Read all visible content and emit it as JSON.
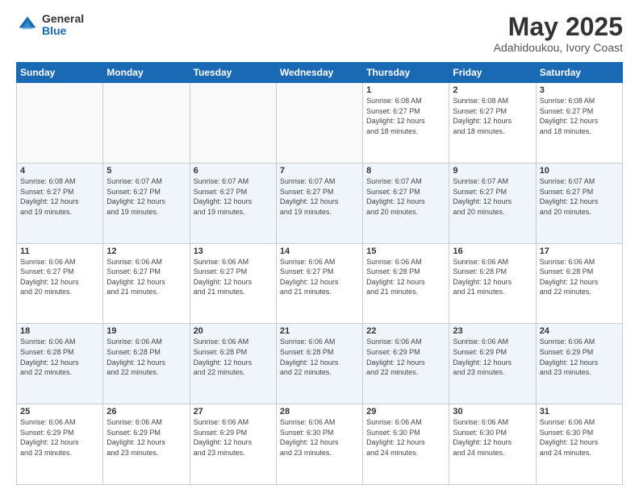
{
  "logo": {
    "general": "General",
    "blue": "Blue"
  },
  "header": {
    "month": "May 2025",
    "location": "Adahidoukou, Ivory Coast"
  },
  "days_of_week": [
    "Sunday",
    "Monday",
    "Tuesday",
    "Wednesday",
    "Thursday",
    "Friday",
    "Saturday"
  ],
  "weeks": [
    [
      {
        "day": "",
        "info": ""
      },
      {
        "day": "",
        "info": ""
      },
      {
        "day": "",
        "info": ""
      },
      {
        "day": "",
        "info": ""
      },
      {
        "day": "1",
        "info": "Sunrise: 6:08 AM\nSunset: 6:27 PM\nDaylight: 12 hours\nand 18 minutes."
      },
      {
        "day": "2",
        "info": "Sunrise: 6:08 AM\nSunset: 6:27 PM\nDaylight: 12 hours\nand 18 minutes."
      },
      {
        "day": "3",
        "info": "Sunrise: 6:08 AM\nSunset: 6:27 PM\nDaylight: 12 hours\nand 18 minutes."
      }
    ],
    [
      {
        "day": "4",
        "info": "Sunrise: 6:08 AM\nSunset: 6:27 PM\nDaylight: 12 hours\nand 19 minutes."
      },
      {
        "day": "5",
        "info": "Sunrise: 6:07 AM\nSunset: 6:27 PM\nDaylight: 12 hours\nand 19 minutes."
      },
      {
        "day": "6",
        "info": "Sunrise: 6:07 AM\nSunset: 6:27 PM\nDaylight: 12 hours\nand 19 minutes."
      },
      {
        "day": "7",
        "info": "Sunrise: 6:07 AM\nSunset: 6:27 PM\nDaylight: 12 hours\nand 19 minutes."
      },
      {
        "day": "8",
        "info": "Sunrise: 6:07 AM\nSunset: 6:27 PM\nDaylight: 12 hours\nand 20 minutes."
      },
      {
        "day": "9",
        "info": "Sunrise: 6:07 AM\nSunset: 6:27 PM\nDaylight: 12 hours\nand 20 minutes."
      },
      {
        "day": "10",
        "info": "Sunrise: 6:07 AM\nSunset: 6:27 PM\nDaylight: 12 hours\nand 20 minutes."
      }
    ],
    [
      {
        "day": "11",
        "info": "Sunrise: 6:06 AM\nSunset: 6:27 PM\nDaylight: 12 hours\nand 20 minutes."
      },
      {
        "day": "12",
        "info": "Sunrise: 6:06 AM\nSunset: 6:27 PM\nDaylight: 12 hours\nand 21 minutes."
      },
      {
        "day": "13",
        "info": "Sunrise: 6:06 AM\nSunset: 6:27 PM\nDaylight: 12 hours\nand 21 minutes."
      },
      {
        "day": "14",
        "info": "Sunrise: 6:06 AM\nSunset: 6:27 PM\nDaylight: 12 hours\nand 21 minutes."
      },
      {
        "day": "15",
        "info": "Sunrise: 6:06 AM\nSunset: 6:28 PM\nDaylight: 12 hours\nand 21 minutes."
      },
      {
        "day": "16",
        "info": "Sunrise: 6:06 AM\nSunset: 6:28 PM\nDaylight: 12 hours\nand 21 minutes."
      },
      {
        "day": "17",
        "info": "Sunrise: 6:06 AM\nSunset: 6:28 PM\nDaylight: 12 hours\nand 22 minutes."
      }
    ],
    [
      {
        "day": "18",
        "info": "Sunrise: 6:06 AM\nSunset: 6:28 PM\nDaylight: 12 hours\nand 22 minutes."
      },
      {
        "day": "19",
        "info": "Sunrise: 6:06 AM\nSunset: 6:28 PM\nDaylight: 12 hours\nand 22 minutes."
      },
      {
        "day": "20",
        "info": "Sunrise: 6:06 AM\nSunset: 6:28 PM\nDaylight: 12 hours\nand 22 minutes."
      },
      {
        "day": "21",
        "info": "Sunrise: 6:06 AM\nSunset: 6:28 PM\nDaylight: 12 hours\nand 22 minutes."
      },
      {
        "day": "22",
        "info": "Sunrise: 6:06 AM\nSunset: 6:29 PM\nDaylight: 12 hours\nand 22 minutes."
      },
      {
        "day": "23",
        "info": "Sunrise: 6:06 AM\nSunset: 6:29 PM\nDaylight: 12 hours\nand 23 minutes."
      },
      {
        "day": "24",
        "info": "Sunrise: 6:06 AM\nSunset: 6:29 PM\nDaylight: 12 hours\nand 23 minutes."
      }
    ],
    [
      {
        "day": "25",
        "info": "Sunrise: 6:06 AM\nSunset: 6:29 PM\nDaylight: 12 hours\nand 23 minutes."
      },
      {
        "day": "26",
        "info": "Sunrise: 6:06 AM\nSunset: 6:29 PM\nDaylight: 12 hours\nand 23 minutes."
      },
      {
        "day": "27",
        "info": "Sunrise: 6:06 AM\nSunset: 6:29 PM\nDaylight: 12 hours\nand 23 minutes."
      },
      {
        "day": "28",
        "info": "Sunrise: 6:06 AM\nSunset: 6:30 PM\nDaylight: 12 hours\nand 23 minutes."
      },
      {
        "day": "29",
        "info": "Sunrise: 6:06 AM\nSunset: 6:30 PM\nDaylight: 12 hours\nand 24 minutes."
      },
      {
        "day": "30",
        "info": "Sunrise: 6:06 AM\nSunset: 6:30 PM\nDaylight: 12 hours\nand 24 minutes."
      },
      {
        "day": "31",
        "info": "Sunrise: 6:06 AM\nSunset: 6:30 PM\nDaylight: 12 hours\nand 24 minutes."
      }
    ]
  ]
}
